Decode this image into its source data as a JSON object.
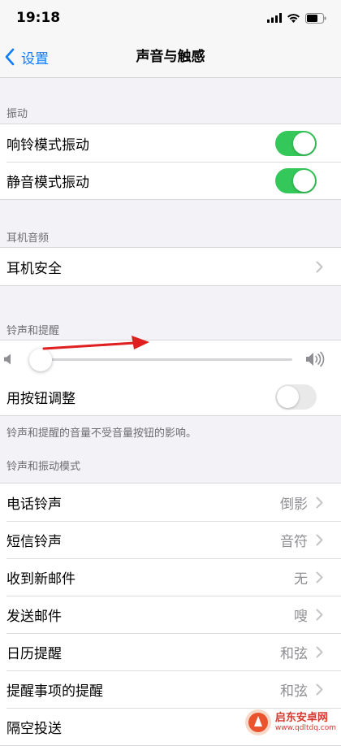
{
  "status_bar": {
    "time": "19:18"
  },
  "nav": {
    "back_label": "设置",
    "title": "声音与触感"
  },
  "sections": {
    "vibration": {
      "header": "振动",
      "rows": [
        {
          "label": "响铃模式振动",
          "toggle": "on"
        },
        {
          "label": "静音模式振动",
          "toggle": "on"
        }
      ]
    },
    "headphone": {
      "header": "耳机音频",
      "rows": [
        {
          "label": "耳机安全"
        }
      ]
    },
    "ringer": {
      "header": "铃声和提醒",
      "volume_level": 0.03,
      "button_adjust_label": "用按钮调整",
      "button_adjust_toggle": "off",
      "footer": "铃声和提醒的音量不受音量按钮的影响。"
    },
    "patterns": {
      "header": "铃声和振动模式",
      "rows": [
        {
          "label": "电话铃声",
          "value": "倒影"
        },
        {
          "label": "短信铃声",
          "value": "音符"
        },
        {
          "label": "收到新邮件",
          "value": "无"
        },
        {
          "label": "发送邮件",
          "value": "嗖"
        },
        {
          "label": "日历提醒",
          "value": "和弦"
        },
        {
          "label": "提醒事项的提醒",
          "value": "和弦"
        },
        {
          "label": "隔空投送",
          "value": ""
        }
      ]
    }
  },
  "watermark": {
    "name": "启东安卓网",
    "url": "www.qdltdq.com"
  },
  "colors": {
    "accent": "#0a7cff",
    "toggle_on": "#34c759",
    "arrow": "#e02020"
  }
}
